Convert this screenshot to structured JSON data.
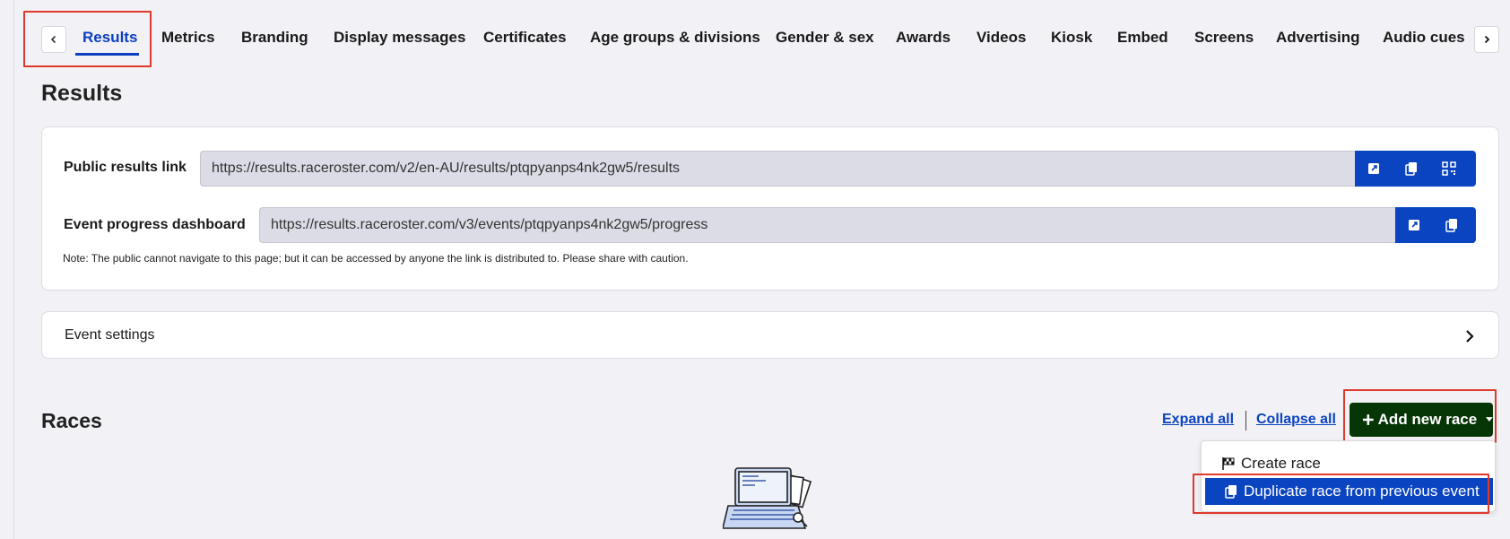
{
  "tabs": {
    "items": [
      "Results",
      "Metrics",
      "Branding",
      "Display messages",
      "Certificates",
      "Age groups & divisions",
      "Gender & sex",
      "Awards",
      "Videos",
      "Kiosk",
      "Embed",
      "Screens",
      "Advertising",
      "Audio cues"
    ],
    "active": "Results",
    "prev_icon": "chevron-left-icon",
    "next_icon": "chevron-right-icon"
  },
  "page": {
    "title": "Results"
  },
  "links_card": {
    "public_results_label": "Public results link",
    "public_results_url": "https://results.raceroster.com/v2/en-AU/results/ptqpyanps4nk2gw5/results",
    "dashboard_label": "Event progress dashboard",
    "dashboard_url": "https://results.raceroster.com/v3/events/ptqpyanps4nk2gw5/progress",
    "note": "Note: The public cannot navigate to this page; but it can be accessed by anyone the link is distributed to. Please share with caution.",
    "action_icons": [
      "open-external-icon",
      "copy-icon",
      "qr-code-icon"
    ]
  },
  "event_settings": {
    "label": "Event settings"
  },
  "races": {
    "title": "Races",
    "expand_all": "Expand all",
    "collapse_all": "Collapse all",
    "add_button": "Add new race",
    "menu": {
      "create": "Create race",
      "duplicate": "Duplicate race from previous event"
    }
  },
  "colors": {
    "accent": "#0b44c0",
    "add_button": "#063506",
    "highlight": "#e0392b",
    "background": "#f2f1f6"
  }
}
